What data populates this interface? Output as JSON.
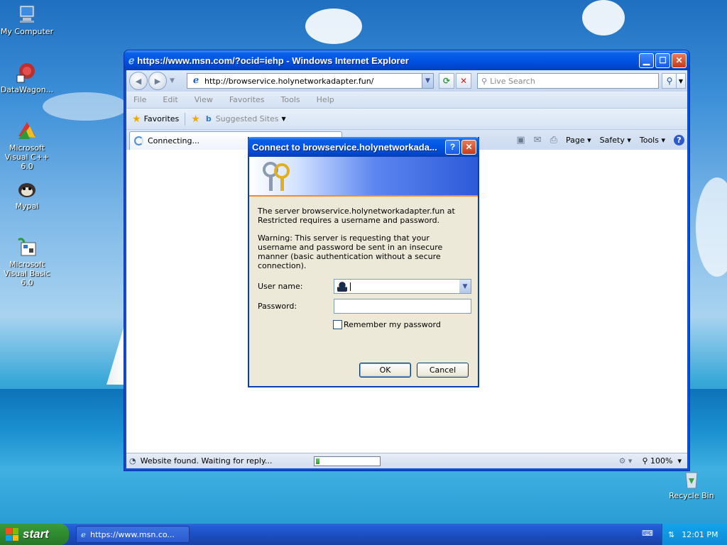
{
  "desktop": {
    "icons": [
      {
        "label": "My Computer"
      },
      {
        "label": "DataWagon..."
      },
      {
        "label": "Microsoft Visual C++ 6.0"
      },
      {
        "label": "Mypal"
      },
      {
        "label": "Microsoft Visual Basic 6.0"
      },
      {
        "label": "Recycle Bin"
      }
    ]
  },
  "ie": {
    "title": "https://www.msn.com/?ocid=iehp - Windows Internet Explorer",
    "address": "http://browservice.holynetworkadapter.fun/",
    "search_placeholder": "Live Search",
    "menu": [
      "File",
      "Edit",
      "View",
      "Favorites",
      "Tools",
      "Help"
    ],
    "favorites_label": "Favorites",
    "suggested_sites": "Suggested Sites",
    "tab_title": "Connecting...",
    "command_bar": {
      "page": "Page",
      "safety": "Safety",
      "tools": "Tools"
    },
    "status_text": "Website found. Waiting for reply...",
    "progress_fraction": 0.06,
    "zoom": "100%"
  },
  "dialog": {
    "title": "Connect to browservice.holynetworkada...",
    "message": "The server browservice.holynetworkadapter.fun at Restricted requires a username and password.",
    "warning": "Warning: This server is requesting that your username and password be sent in an insecure manner (basic authentication without a secure connection).",
    "username_label": "User name:",
    "username_value": "",
    "password_label": "Password:",
    "remember_label": "Remember my password",
    "remember_checked": false,
    "ok_label": "OK",
    "cancel_label": "Cancel"
  },
  "taskbar": {
    "start_label": "start",
    "task_label": "https://www.msn.co...",
    "clock": "12:01 PM"
  },
  "colors": {
    "title_blue": "#0054e3",
    "taskbar_blue": "#245edb",
    "start_green": "#2e8b2e",
    "dialog_face": "#ece9d8"
  }
}
